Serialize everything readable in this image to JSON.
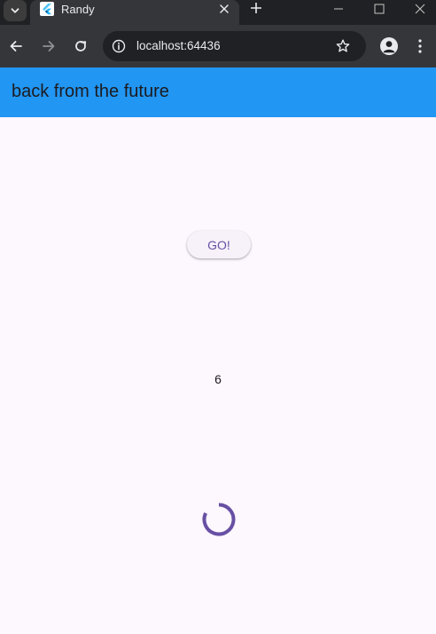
{
  "browser": {
    "tab": {
      "title": "Randy",
      "favicon": "flutter-logo-icon"
    },
    "address_bar": {
      "url": "localhost:64436"
    },
    "icons": {
      "tab_list": "chevron-down-icon",
      "tab_close": "close-icon",
      "new_tab": "plus-icon",
      "minimize": "minimize-icon",
      "maximize": "maximize-icon",
      "close_window": "close-icon",
      "back": "arrow-left-icon",
      "forward": "arrow-right-icon",
      "reload": "reload-icon",
      "site_info": "info-icon",
      "bookmark": "star-icon",
      "profile": "person-icon",
      "menu": "more-vert-icon"
    }
  },
  "app": {
    "app_bar": {
      "title": "back from the future",
      "color": "#2196f3"
    },
    "go_button": {
      "label": "GO!"
    },
    "counter": {
      "value": "6"
    },
    "progress": {
      "type": "indeterminate-circular",
      "color": "#6750a4"
    },
    "background_color": "#fdf7fe"
  }
}
